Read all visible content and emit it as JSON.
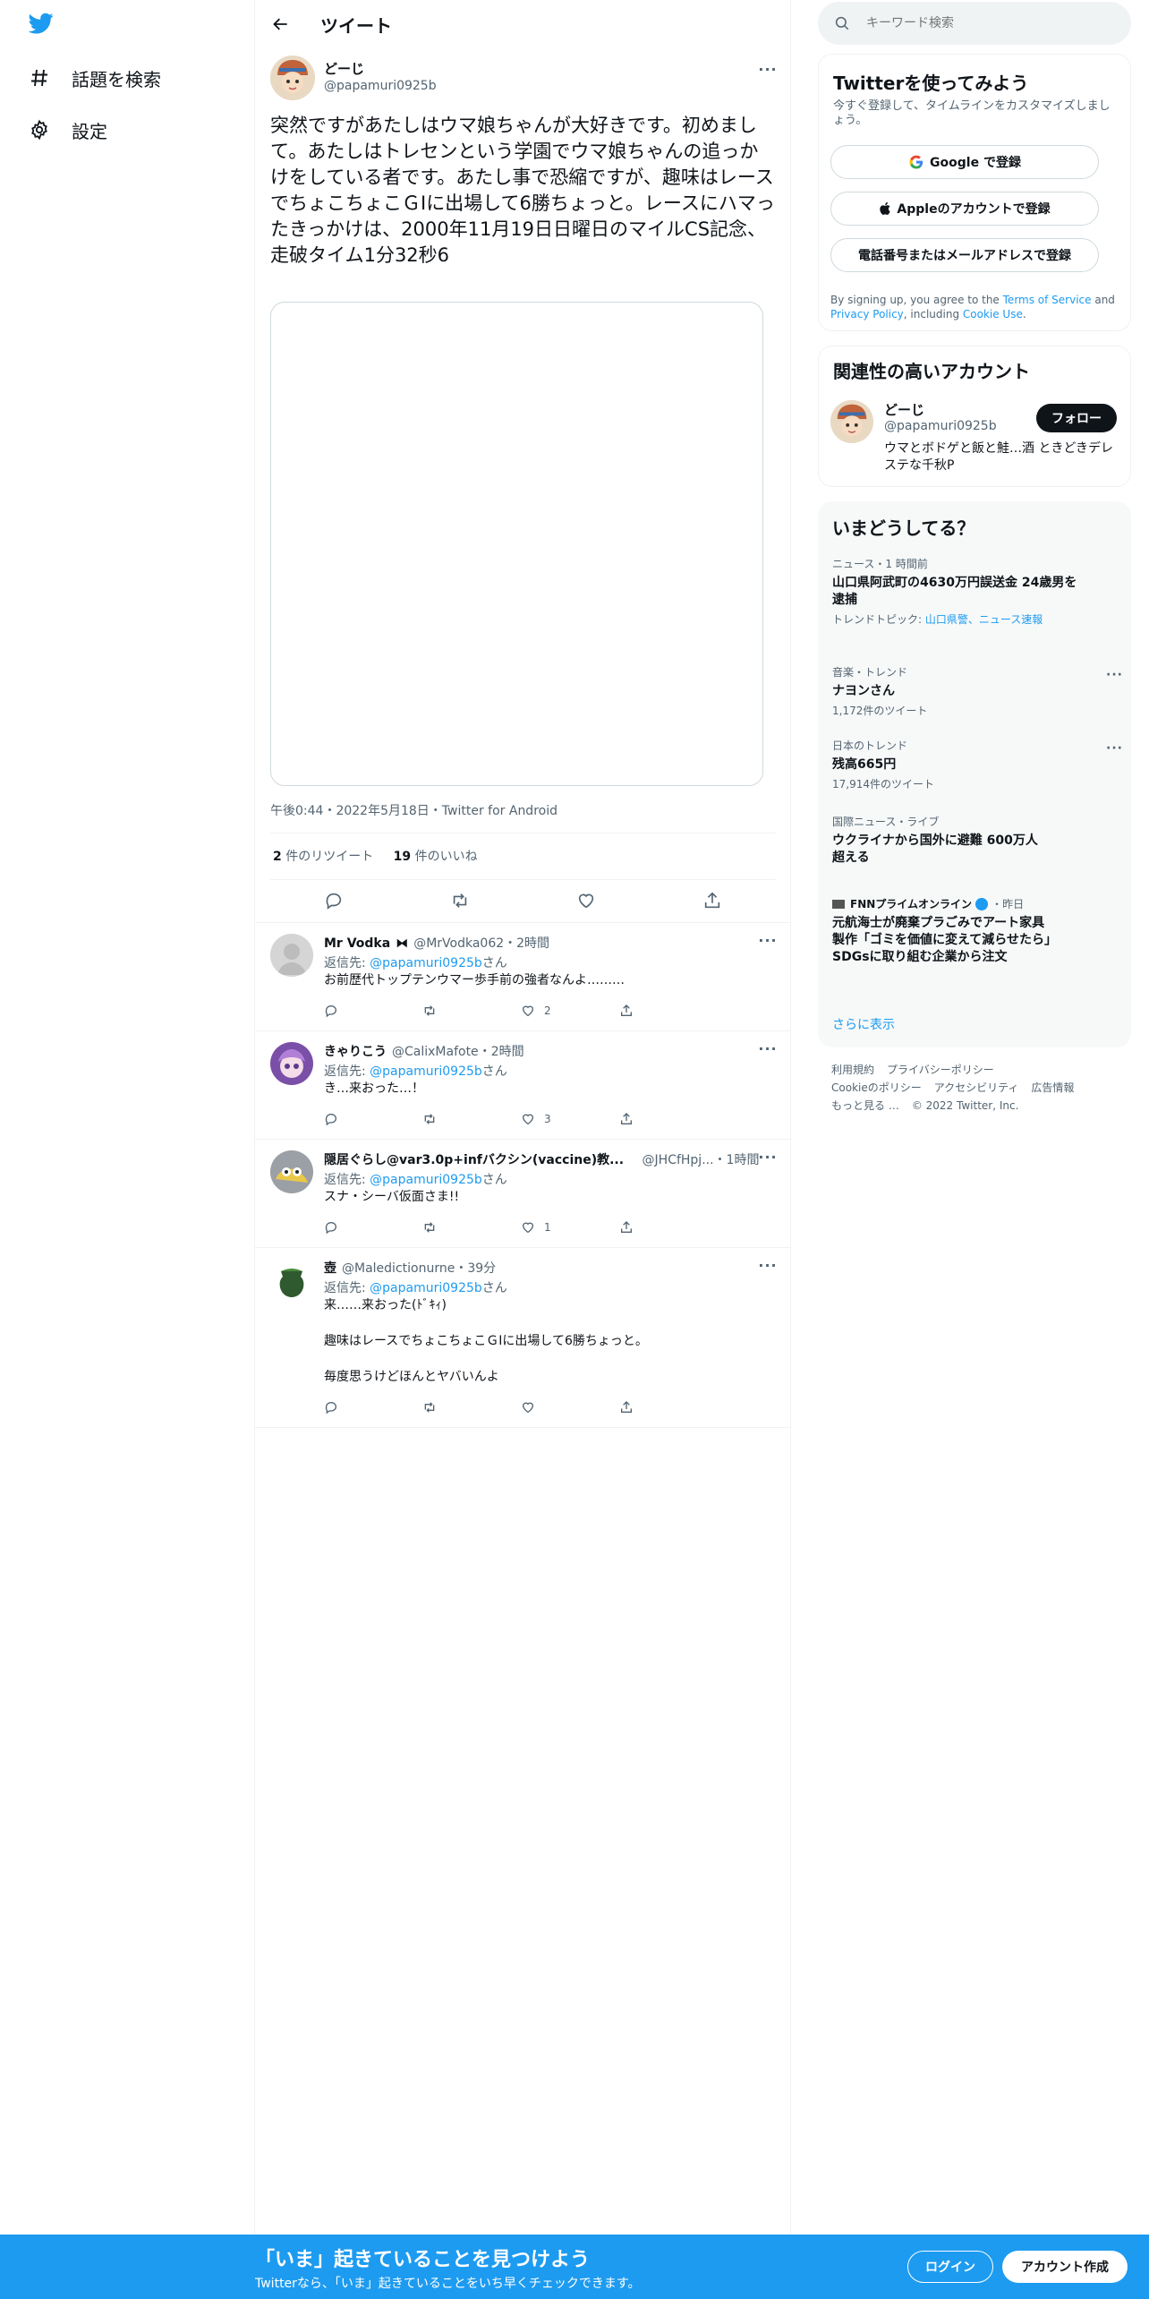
{
  "nav": {
    "explore_label": "話題を検索",
    "settings_label": "設定"
  },
  "header": {
    "title": "ツイート"
  },
  "main_tweet": {
    "name": "どーじ",
    "handle": "@papamuri0925b",
    "text": "突然ですがあたしはウマ娘ちゃんが大好きです。初めまして。あたしはトレセンという学園でウマ娘ちゃんの追っかけをしている者です。あたし事で恐縮ですが、趣味はレースでちょこちょこＧⅠに出場して6勝ちょっと。レースにハマったきっかけは、2000年11月19日日曜日のマイルCS記念、走破タイム1分32秒6",
    "meta": "午後0:44・2022年5月18日・Twitter for Android",
    "retweets": "2",
    "retweets_label": "件のリツイート",
    "likes": "19",
    "likes_label": "件のいいね"
  },
  "replies": [
    {
      "name": "Mr Vodka",
      "badge": "⧓",
      "handle": "@MrVodka062",
      "time": "2時間",
      "to_prefix": "返信先: ",
      "to": "@papamuri0925b",
      "to_suffix": "さん",
      "text": "お前歴代トップテンウマー歩手前の強者なんよ………",
      "likes": "2"
    },
    {
      "name": "きゃりこう",
      "handle": "@CalixMafote",
      "time": "2時間",
      "to_prefix": "返信先: ",
      "to": "@papamuri0925b",
      "to_suffix": "さん",
      "text": "き…来おった…！",
      "likes": "3"
    },
    {
      "name": "隠居ぐらし@var3.0p+infバクシン(vaccine)教...",
      "handle": "@JHCfHpj...",
      "time": "1時間",
      "to_prefix": "返信先: ",
      "to": "@papamuri0925b",
      "to_suffix": "さん",
      "text": "スナ・シーバ仮面さま!!",
      "likes": "1"
    },
    {
      "name": "壺",
      "handle": "@Maledictionurne",
      "time": "39分",
      "to_prefix": "返信先: ",
      "to": "@papamuri0925b",
      "to_suffix": "さん",
      "text": "来……来おった(ﾄﾞｷｨ)\n\n趣味はレースでちょこちょこＧⅠに出場して6勝ちょっと。\n\n毎度思うけどほんとヤバいんよ",
      "likes": ""
    }
  ],
  "search": {
    "placeholder": "キーワード検索"
  },
  "signup_card": {
    "title": "Twitterを使ってみよう",
    "subtitle": "今すぐ登録して、タイムラインをカスタマイズしましょう。",
    "google": "Google で登録",
    "apple": "Appleのアカウントで登録",
    "phone": "電話番号またはメールアドレスで登録",
    "terms_1": "By signing up, you agree to the ",
    "terms_link": "Terms of Service",
    "terms_2": " and ",
    "privacy_link": "Privacy Policy",
    "terms_3": ", including ",
    "cookie_link": "Cookie Use",
    "terms_4": "."
  },
  "related": {
    "title": "関連性の高いアカウント",
    "name": "どーじ",
    "handle": "@papamuri0925b",
    "bio": "ウマとボドゲと飯と鮭…酒 ときどきデレステな千秋P",
    "follow": "フォロー"
  },
  "trends": {
    "title": "いまどうしてる？",
    "items": [
      {
        "category": "ニュース・1 時間前",
        "title": "山口県阿武町の4630万円誤送金 24歳男を逮捕",
        "sub_prefix": "トレンドトピック: ",
        "sub_links": "山口県警、ニュース速報"
      },
      {
        "category": "音楽・トレンド",
        "title": "ナヨンさん",
        "count": "1,172件のツイート"
      },
      {
        "category": "日本のトレンド",
        "title": "残高665円",
        "count": "17,914件のツイート"
      },
      {
        "category": "国際ニュース・ライブ",
        "title": "ウクライナから国外に避難 600万人超える"
      },
      {
        "source": "FNNプライムオンライン",
        "time": "昨日",
        "title": "元航海士が廃棄プラごみでアート家具製作「ゴミを価値に変えて減らせたら」　SDGsに取り組む企業から注文"
      }
    ],
    "show_more": "さらに表示"
  },
  "footer": {
    "links": [
      "利用規約",
      "プライバシーポリシー",
      "Cookieのポリシー",
      "アクセシビリティ",
      "広告情報",
      "もっと見る …"
    ],
    "copyright": "© 2022 Twitter, Inc."
  },
  "bottom_bar": {
    "title": "「いま」起きていることを見つけよう",
    "subtitle": "Twitterなら、「いま」起きていることをいち早くチェックできます。",
    "login": "ログイン",
    "signup": "アカウント作成"
  },
  "colors": {
    "accent": "#1d9bf0",
    "text": "#0f1419",
    "muted": "#536471",
    "border": "#eff3f4"
  }
}
